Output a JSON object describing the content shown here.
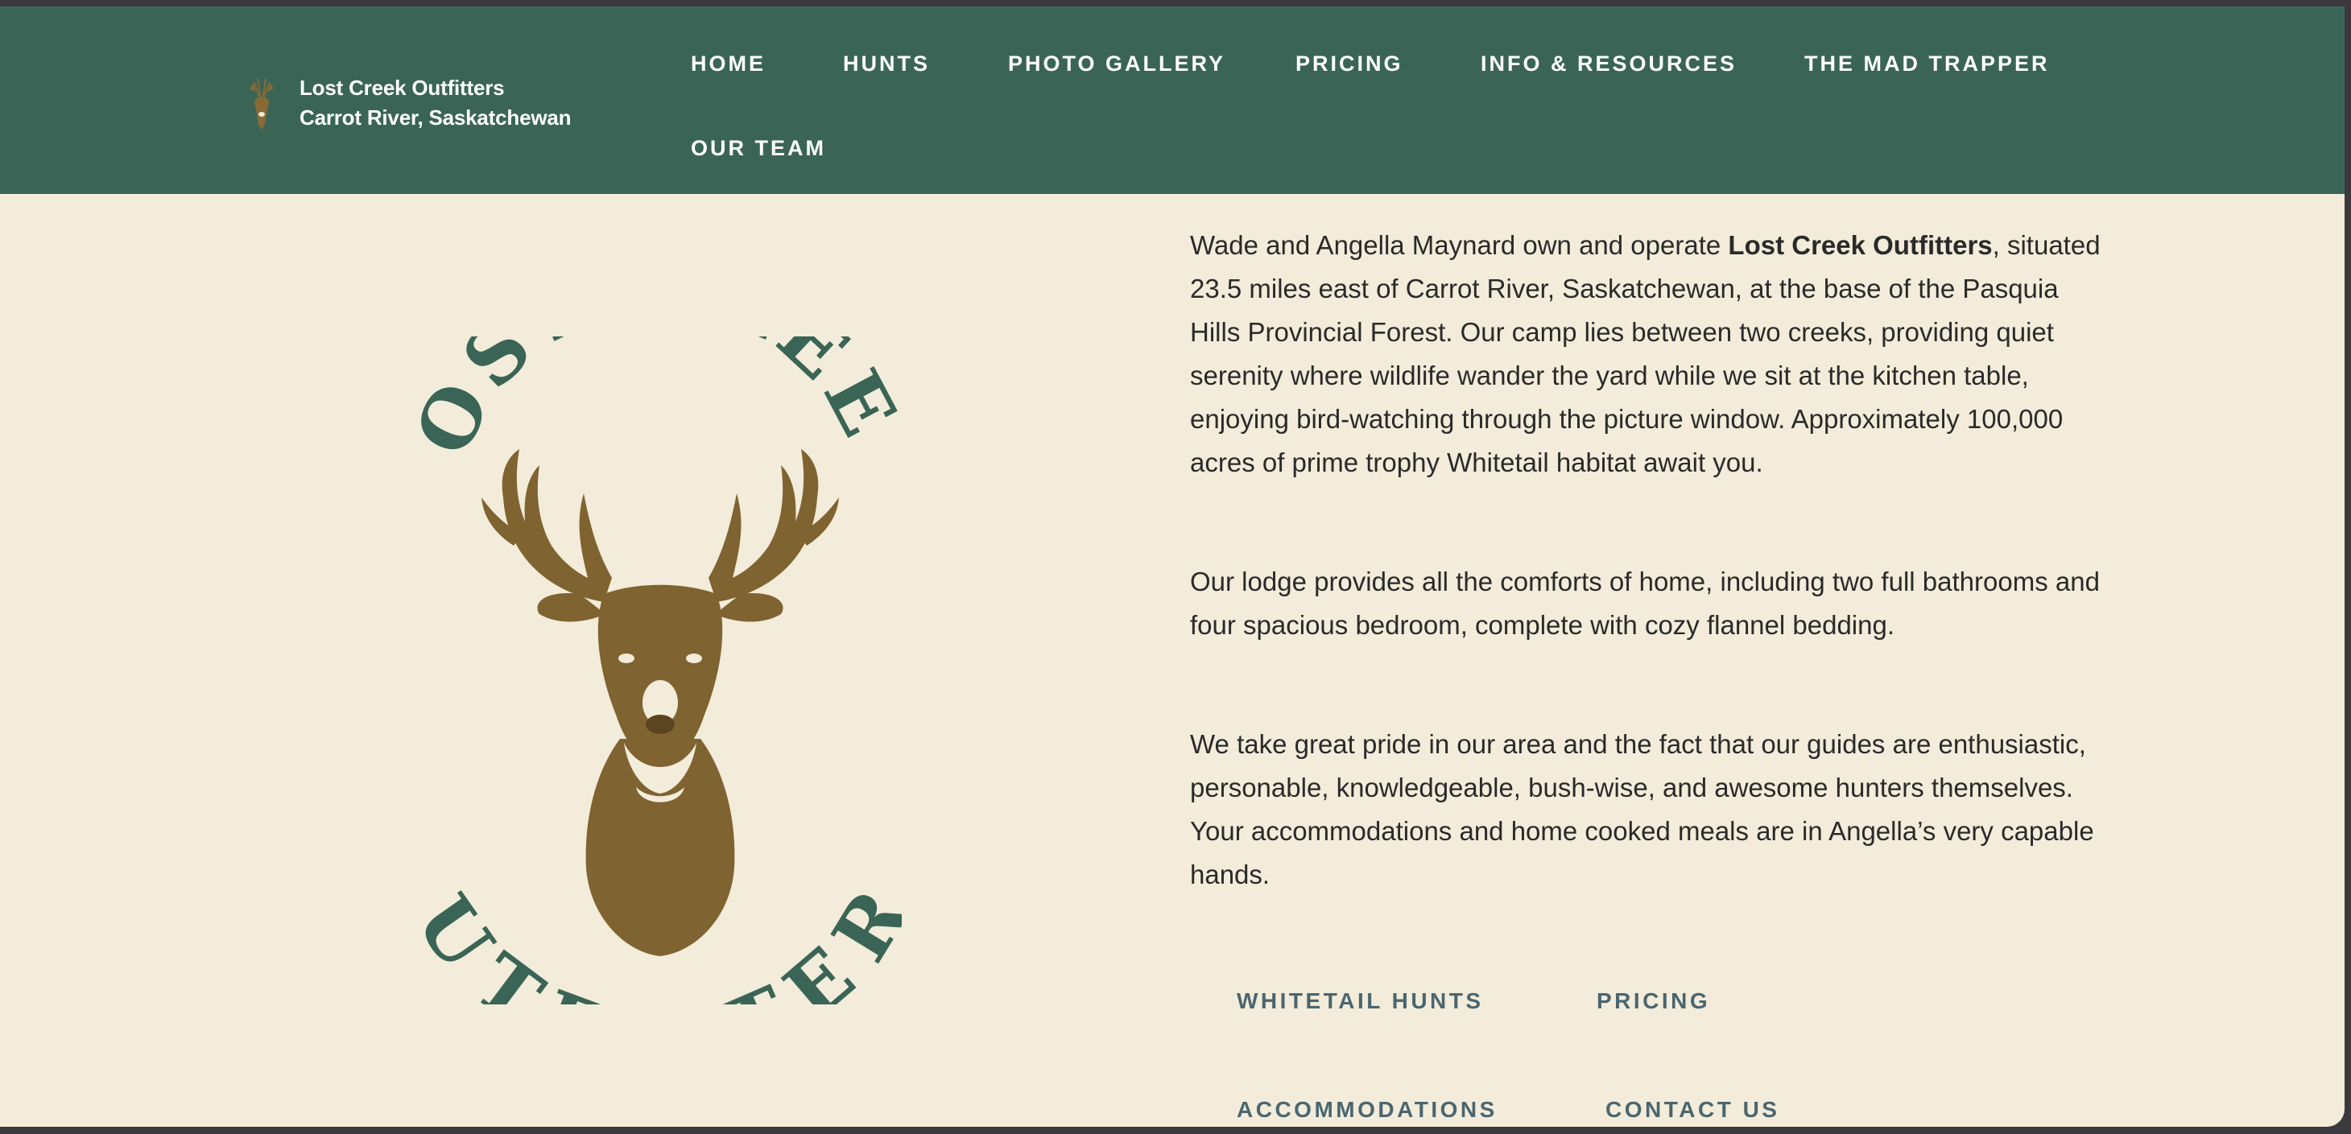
{
  "header": {
    "brand_name": "Lost Creek Outfitters",
    "brand_location": "Carrot River, Saskatchewan",
    "brand_icon": "deer-head-icon",
    "background_color": "#3a6556"
  },
  "nav": {
    "items": [
      {
        "label": "HOME"
      },
      {
        "label": "HUNTS"
      },
      {
        "label": "PHOTO GALLERY"
      },
      {
        "label": "PRICING"
      },
      {
        "label": "INFO & RESOURCES"
      },
      {
        "label": "THE MAD TRAPPER"
      },
      {
        "label": "OUR TEAM"
      }
    ]
  },
  "logo": {
    "top_text": "LOST CREEK",
    "bottom_text": "OUTFITTERS",
    "text_color": "#3a6556",
    "deer_color": "#7f6330"
  },
  "content": {
    "p1_before": "Wade and Angella Maynard own and operate ",
    "p1_bold": "Lost Creek Outfitters",
    "p1_after": ", situated 23.5 miles east of Carrot River, Saskatchewan, at the base of the Pasquia Hills Provincial Forest. Our camp lies between two creeks, providing quiet serenity where wildlife wander the yard while we sit at the kitchen table, enjoying bird-watching through the picture window. Approximately 100,000 acres of prime trophy Whitetail habitat await you.",
    "p2": "Our lodge provides all the comforts of home, including two full bathrooms and four spacious bedroom, complete with cozy flannel bedding.",
    "p3": "We take great pride in our area and the fact that our guides are enthusiastic, personable, knowledgeable, bush-wise, and awesome hunters themselves. Your accommodations and home cooked meals are in Angella’s very capable hands."
  },
  "cta_links": {
    "whitetail": "WHITETAIL HUNTS",
    "pricing": "PRICING",
    "accommodations": "ACCOMMODATIONS",
    "contact": "CONTACT US"
  },
  "colors": {
    "page_background": "#f3ecda",
    "body_text": "#2a2a2a",
    "cta_text": "#4a6670"
  }
}
